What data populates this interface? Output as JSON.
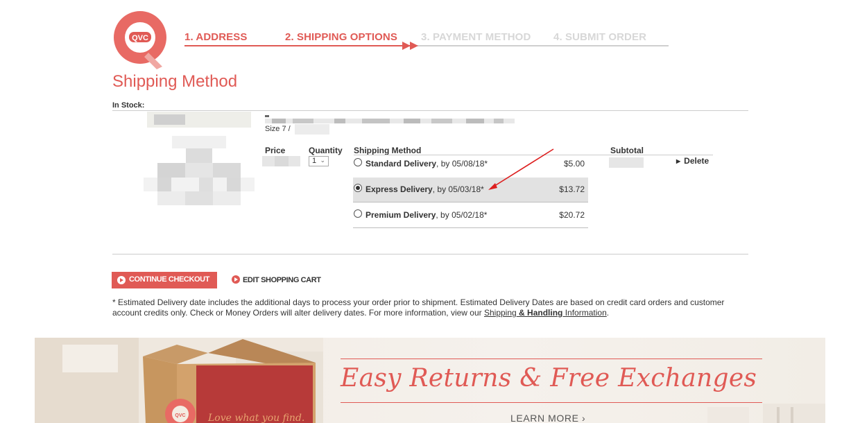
{
  "brand": {
    "logo_text": "QVC",
    "accent_color": "#e05a55"
  },
  "steps": [
    {
      "label": "1. ADDRESS",
      "state": "done"
    },
    {
      "label": "2. SHIPPING OPTIONS",
      "state": "current"
    },
    {
      "label": "3. PAYMENT METHOD",
      "state": "todo"
    },
    {
      "label": "4. SUBMIT ORDER",
      "state": "todo"
    }
  ],
  "page_title": "Shipping Method",
  "stock_label": "In Stock:",
  "item": {
    "size_label": "Size 7 /",
    "columns": {
      "price": "Price",
      "quantity": "Quantity",
      "shipping_method": "Shipping Method",
      "subtotal": "Subtotal"
    },
    "quantity_value": "1",
    "shipping_options": [
      {
        "name": "Standard Delivery",
        "date_text": ", by 05/08/18*",
        "price": "$5.00",
        "selected": false
      },
      {
        "name": "Express Delivery",
        "date_text": ", by 05/03/18*",
        "price": "$13.72",
        "selected": true
      },
      {
        "name": "Premium Delivery",
        "date_text": ", by 05/02/18*",
        "price": "$20.72",
        "selected": false
      }
    ],
    "delete_label": "Delete"
  },
  "actions": {
    "continue_label": "CONTINUE CHECKOUT",
    "edit_cart_label": "EDIT SHOPPING CART"
  },
  "note": {
    "text": "* Estimated Delivery date includes the additional days to process your order prior to shipment. Estimated Delivery Dates are based on credit card orders and customer account credits only. Check or Money Orders will alter delivery dates. For more information, view our ",
    "link_part1": "Shipping",
    "link_part2": " & Handling",
    "link_part3": " Information",
    "suffix": "."
  },
  "banner": {
    "title": "Easy Returns & Free Exchanges",
    "cta": "LEARN MORE ›",
    "box_text": "Love what you find.",
    "box_logo": "QVC"
  }
}
